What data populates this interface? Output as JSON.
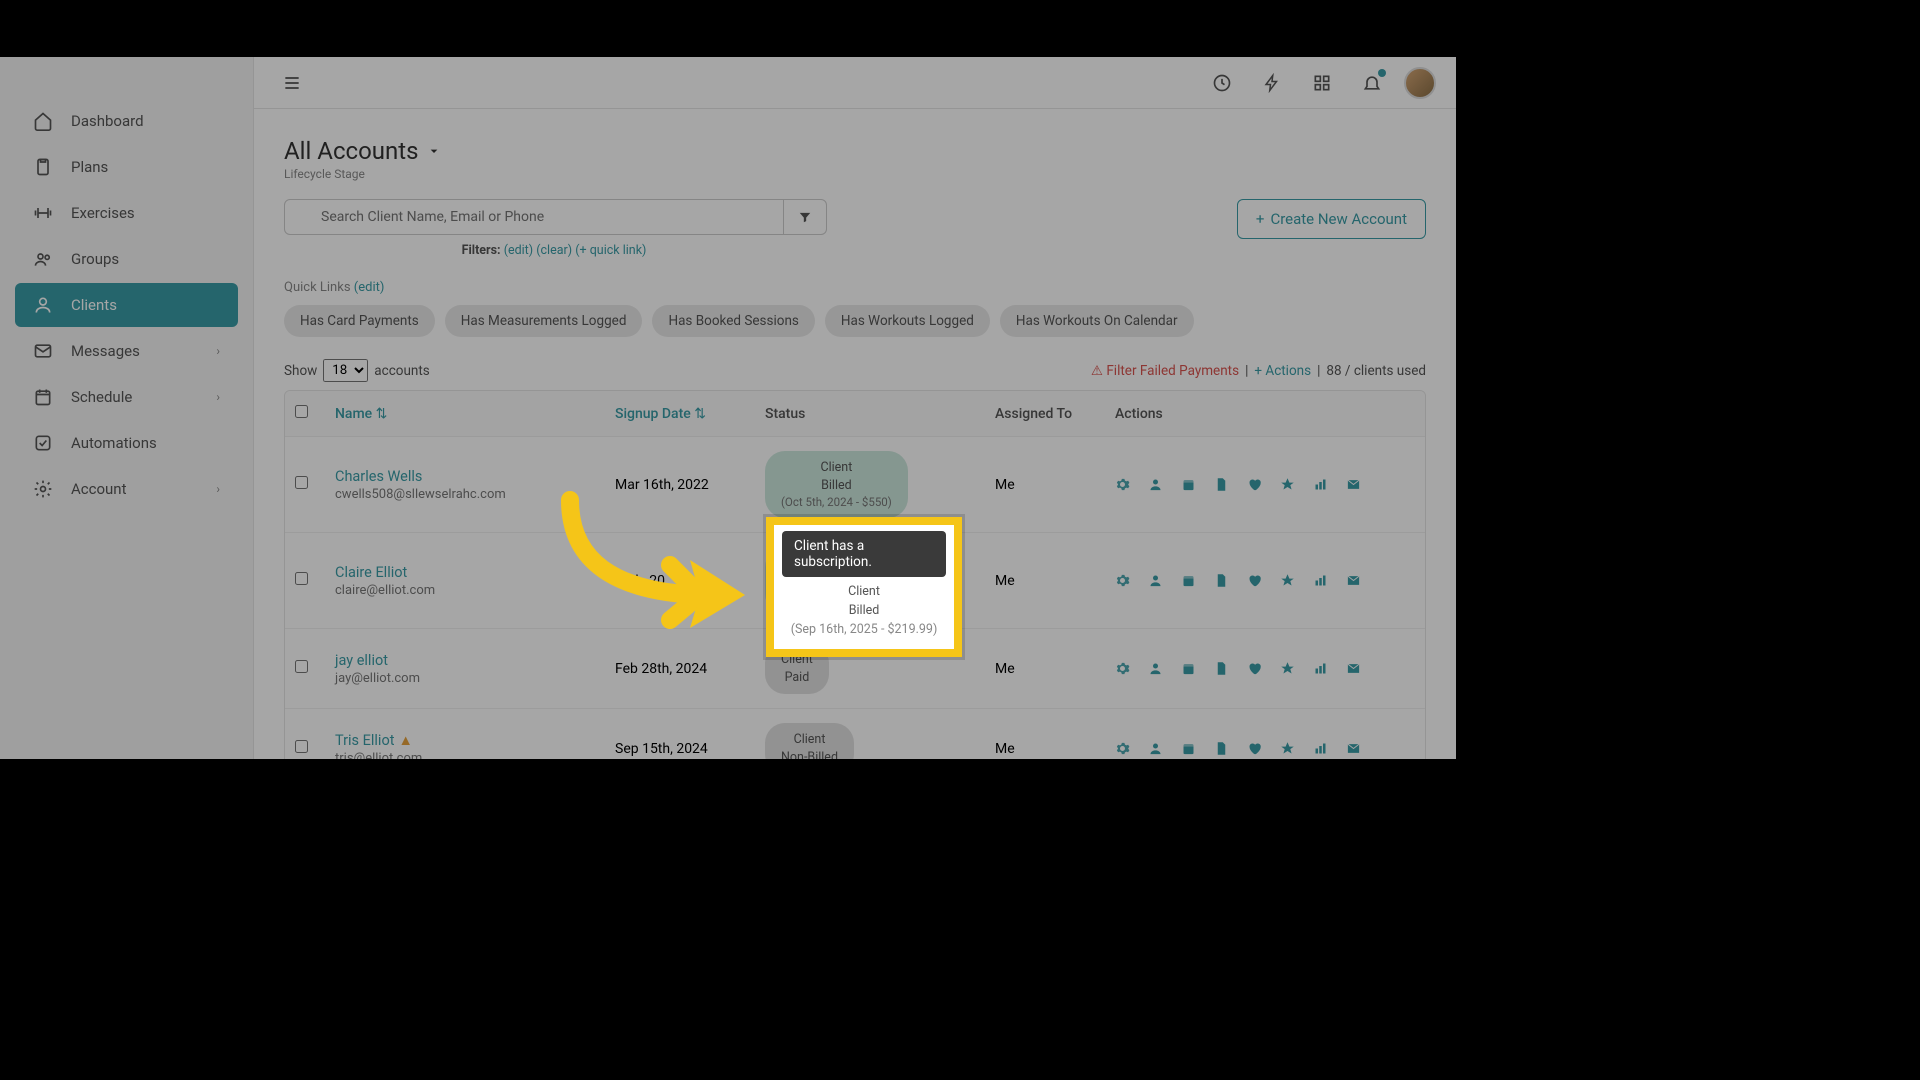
{
  "sidebar": {
    "items": [
      {
        "label": "Dashboard",
        "icon": "home"
      },
      {
        "label": "Plans",
        "icon": "clipboard"
      },
      {
        "label": "Exercises",
        "icon": "dumbbell"
      },
      {
        "label": "Groups",
        "icon": "users"
      },
      {
        "label": "Clients",
        "icon": "user",
        "active": true
      },
      {
        "label": "Messages",
        "icon": "mail",
        "chev": true
      },
      {
        "label": "Schedule",
        "icon": "calendar",
        "chev": true
      },
      {
        "label": "Automations",
        "icon": "check"
      },
      {
        "label": "Account",
        "icon": "gear",
        "chev": true
      }
    ]
  },
  "header": {
    "title": "All Accounts",
    "subtitle": "Lifecycle Stage",
    "search_placeholder": "Search Client Name, Email or Phone",
    "create_label": "Create New Account"
  },
  "filters": {
    "label": "Filters:",
    "edit": "(edit)",
    "clear": "(clear)",
    "quicklink": "(+ quick link)"
  },
  "quicklinks": {
    "label": "Quick Links",
    "edit": "(edit)",
    "chips": [
      "Has Card Payments",
      "Has Measurements Logged",
      "Has Booked Sessions",
      "Has Workouts Logged",
      "Has Workouts On Calendar"
    ]
  },
  "toolbar": {
    "show": "Show",
    "count": "18",
    "accounts": "accounts",
    "failed": "Filter Failed Payments",
    "actions": "Actions",
    "usage": "88 / clients used"
  },
  "table": {
    "headers": {
      "name": "Name",
      "signup": "Signup Date",
      "status": "Status",
      "assigned": "Assigned To",
      "actions": "Actions"
    },
    "rows": [
      {
        "name": "Charles Wells",
        "email": "cwells508@sllewselrahc.com",
        "signup": "Mar 16th, 2022",
        "status_l1": "Client",
        "status_l2": "Billed",
        "status_l3": "(Oct 5th, 2024 - $550)",
        "pill": "billed",
        "assigned": "Me"
      },
      {
        "name": "Claire Elliot",
        "email": "claire@elliot.com",
        "signup": "13th, 20",
        "status_l1": "Client",
        "status_l2": "Billed",
        "status_l3": "(Sep 16th, 2025 - $219.99)",
        "pill": "billed2",
        "assigned": "Me"
      },
      {
        "name": "jay elliot",
        "email": "jay@elliot.com",
        "signup": "Feb 28th, 2024",
        "status_l1": "Client",
        "status_l2": "Paid",
        "status_l3": "",
        "pill": "paid",
        "assigned": "Me"
      },
      {
        "name": "Tris Elliot",
        "email": "tris@elliot.com",
        "signup": "Sep 15th, 2024",
        "status_l1": "Client",
        "status_l2": "Non-Billed",
        "status_l3": "",
        "pill": "nonbilled",
        "assigned": "Me",
        "warn": true
      }
    ]
  },
  "tooltip": {
    "text": "Client has a subscription."
  },
  "highlight": {
    "l1": "Client",
    "l2": "Billed",
    "l3": "(Sep 16th, 2025 - $219.99)"
  }
}
